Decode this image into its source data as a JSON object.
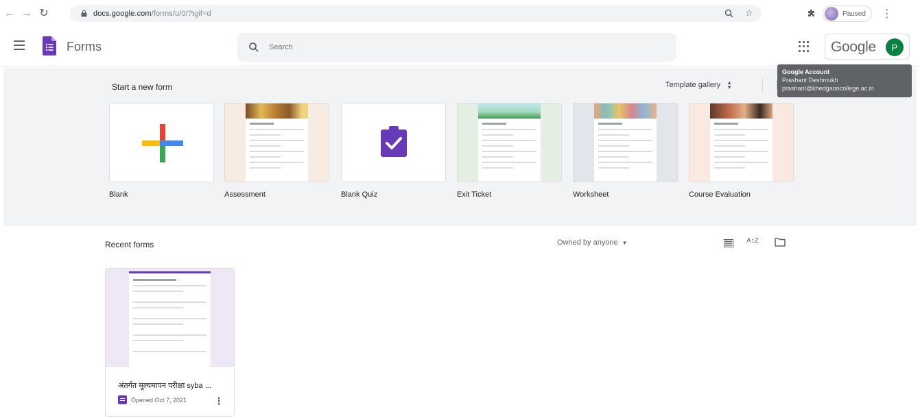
{
  "browser": {
    "url_host": "docs.google.com",
    "url_path": "/forms/u/0/?tgif=d",
    "profile_status": "Paused"
  },
  "app": {
    "title": "Forms",
    "search_placeholder": "Search",
    "google_label": "Google",
    "avatar_letter": "P",
    "accent_color": "#673ab7"
  },
  "tooltip": {
    "title": "Google Account",
    "name": "Prashant Deshmukh",
    "email": "prashant@khedgaoncollege.ac.in"
  },
  "templates": {
    "section_label": "Start a new form",
    "gallery_label": "Template gallery",
    "items": [
      {
        "label": "Blank"
      },
      {
        "label": "Assessment"
      },
      {
        "label": "Blank Quiz"
      },
      {
        "label": "Exit Ticket"
      },
      {
        "label": "Worksheet"
      },
      {
        "label": "Course Evaluation"
      }
    ]
  },
  "recent": {
    "section_label": "Recent forms",
    "owner_filter": "Owned by anyone",
    "docs": [
      {
        "title": "अंतर्गत मूल्यमापन परीक्षा syba ...",
        "meta": "Opened Oct 7, 2021"
      }
    ]
  }
}
